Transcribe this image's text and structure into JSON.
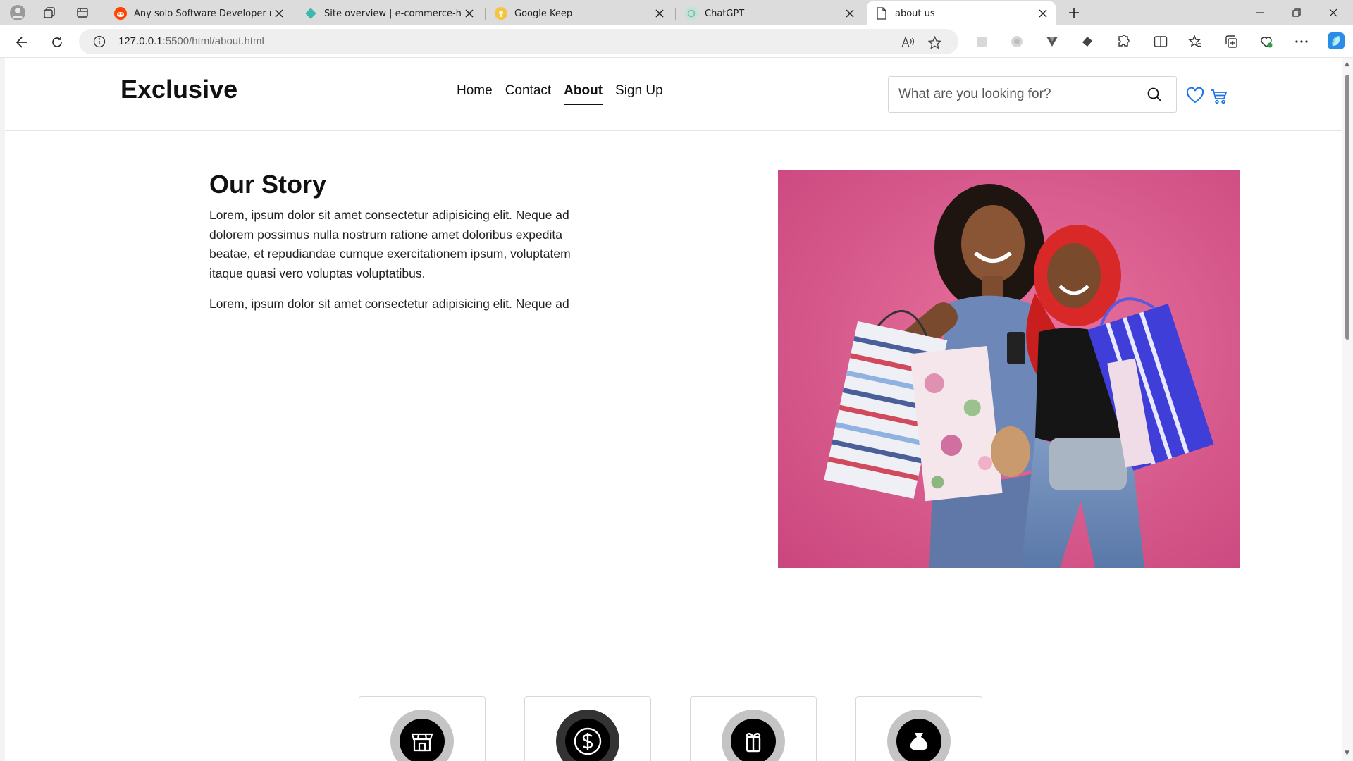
{
  "browser": {
    "tabs": [
      {
        "title": "Any solo Software Developer ma",
        "icon": "reddit-icon",
        "active": false
      },
      {
        "title": "Site overview | e-commerce-htm",
        "icon": "netlify-icon",
        "active": false
      },
      {
        "title": "Google Keep",
        "icon": "google-keep-icon",
        "active": false
      },
      {
        "title": "ChatGPT",
        "icon": "chatgpt-icon",
        "active": false
      },
      {
        "title": "about us",
        "icon": "page-icon",
        "active": true
      }
    ],
    "url_host": "127.0.0.1",
    "url_path": ":5500/html/about.html"
  },
  "site": {
    "logo": "Exclusive",
    "nav": [
      {
        "label": "Home",
        "active": false
      },
      {
        "label": "Contact",
        "active": false
      },
      {
        "label": "About",
        "active": true
      },
      {
        "label": "Sign Up",
        "active": false
      }
    ],
    "search_placeholder": "What are you looking for?",
    "accent": "#1a73e8"
  },
  "story": {
    "title": "Our Story",
    "p1": "Lorem, ipsum dolor sit amet consectetur adipisicing elit. Neque ad dolorem possimus nulla nostrum ratione amet doloribus expedita beatae, et repudiandae cumque exercitationem ipsum, voluptatem itaque quasi vero voluptas voluptatibus.",
    "p2": "Lorem, ipsum dolor sit amet consectetur adipisicing elit. Neque ad"
  },
  "stats": [
    {
      "icon": "shop-icon"
    },
    {
      "icon": "dollar-icon"
    },
    {
      "icon": "gift-icon"
    },
    {
      "icon": "moneybag-icon"
    }
  ]
}
